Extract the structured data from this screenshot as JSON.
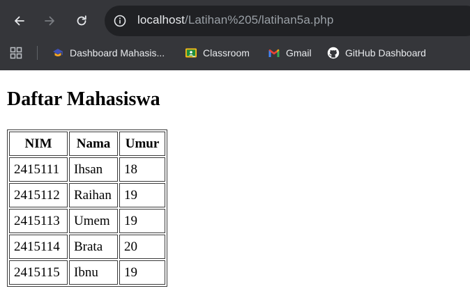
{
  "browser": {
    "url_host": "localhost",
    "url_path": "/Latihan%205/latihan5a.php",
    "bookmarks": [
      {
        "label": "Dashboard Mahasis...",
        "icon": "dashboard-favicon"
      },
      {
        "label": "Classroom",
        "icon": "classroom-favicon"
      },
      {
        "label": "Gmail",
        "icon": "gmail-favicon"
      },
      {
        "label": "GitHub Dashboard",
        "icon": "github-favicon"
      }
    ]
  },
  "page": {
    "title": "Daftar Mahasiswa",
    "table": {
      "headers": [
        "NIM",
        "Nama",
        "Umur"
      ],
      "rows": [
        [
          "2415111",
          "Ihsan",
          "18"
        ],
        [
          "2415112",
          "Raihan",
          "19"
        ],
        [
          "2415113",
          "Umem",
          "19"
        ],
        [
          "2415114",
          "Brata",
          "20"
        ],
        [
          "2415115",
          "Ibnu",
          "19"
        ]
      ]
    }
  }
}
